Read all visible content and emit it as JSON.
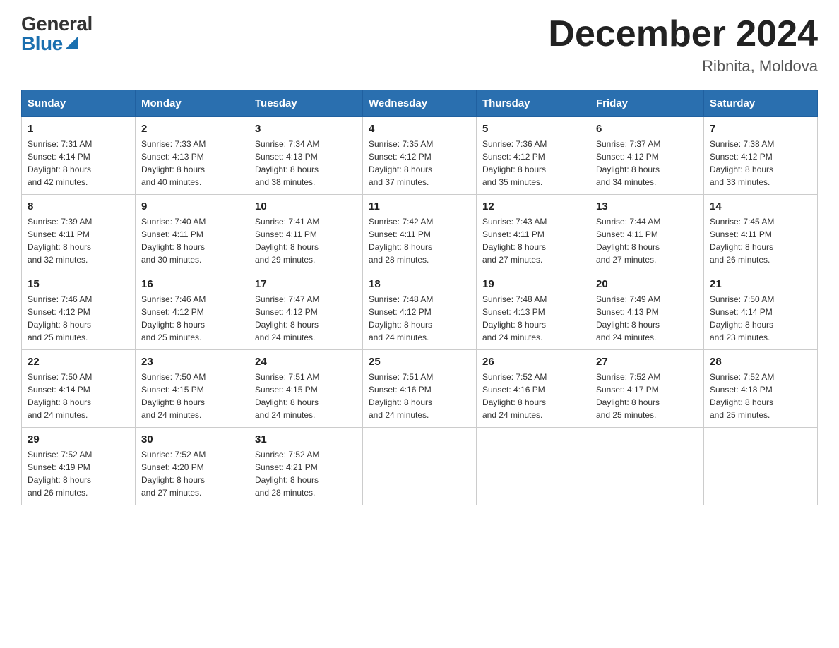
{
  "logo": {
    "general": "General",
    "blue": "Blue"
  },
  "header": {
    "title": "December 2024",
    "subtitle": "Ribnita, Moldova"
  },
  "days_of_week": [
    "Sunday",
    "Monday",
    "Tuesday",
    "Wednesday",
    "Thursday",
    "Friday",
    "Saturday"
  ],
  "weeks": [
    [
      {
        "day": "1",
        "sunrise": "7:31 AM",
        "sunset": "4:14 PM",
        "daylight": "8 hours and 42 minutes."
      },
      {
        "day": "2",
        "sunrise": "7:33 AM",
        "sunset": "4:13 PM",
        "daylight": "8 hours and 40 minutes."
      },
      {
        "day": "3",
        "sunrise": "7:34 AM",
        "sunset": "4:13 PM",
        "daylight": "8 hours and 38 minutes."
      },
      {
        "day": "4",
        "sunrise": "7:35 AM",
        "sunset": "4:12 PM",
        "daylight": "8 hours and 37 minutes."
      },
      {
        "day": "5",
        "sunrise": "7:36 AM",
        "sunset": "4:12 PM",
        "daylight": "8 hours and 35 minutes."
      },
      {
        "day": "6",
        "sunrise": "7:37 AM",
        "sunset": "4:12 PM",
        "daylight": "8 hours and 34 minutes."
      },
      {
        "day": "7",
        "sunrise": "7:38 AM",
        "sunset": "4:12 PM",
        "daylight": "8 hours and 33 minutes."
      }
    ],
    [
      {
        "day": "8",
        "sunrise": "7:39 AM",
        "sunset": "4:11 PM",
        "daylight": "8 hours and 32 minutes."
      },
      {
        "day": "9",
        "sunrise": "7:40 AM",
        "sunset": "4:11 PM",
        "daylight": "8 hours and 30 minutes."
      },
      {
        "day": "10",
        "sunrise": "7:41 AM",
        "sunset": "4:11 PM",
        "daylight": "8 hours and 29 minutes."
      },
      {
        "day": "11",
        "sunrise": "7:42 AM",
        "sunset": "4:11 PM",
        "daylight": "8 hours and 28 minutes."
      },
      {
        "day": "12",
        "sunrise": "7:43 AM",
        "sunset": "4:11 PM",
        "daylight": "8 hours and 27 minutes."
      },
      {
        "day": "13",
        "sunrise": "7:44 AM",
        "sunset": "4:11 PM",
        "daylight": "8 hours and 27 minutes."
      },
      {
        "day": "14",
        "sunrise": "7:45 AM",
        "sunset": "4:11 PM",
        "daylight": "8 hours and 26 minutes."
      }
    ],
    [
      {
        "day": "15",
        "sunrise": "7:46 AM",
        "sunset": "4:12 PM",
        "daylight": "8 hours and 25 minutes."
      },
      {
        "day": "16",
        "sunrise": "7:46 AM",
        "sunset": "4:12 PM",
        "daylight": "8 hours and 25 minutes."
      },
      {
        "day": "17",
        "sunrise": "7:47 AM",
        "sunset": "4:12 PM",
        "daylight": "8 hours and 24 minutes."
      },
      {
        "day": "18",
        "sunrise": "7:48 AM",
        "sunset": "4:12 PM",
        "daylight": "8 hours and 24 minutes."
      },
      {
        "day": "19",
        "sunrise": "7:48 AM",
        "sunset": "4:13 PM",
        "daylight": "8 hours and 24 minutes."
      },
      {
        "day": "20",
        "sunrise": "7:49 AM",
        "sunset": "4:13 PM",
        "daylight": "8 hours and 24 minutes."
      },
      {
        "day": "21",
        "sunrise": "7:50 AM",
        "sunset": "4:14 PM",
        "daylight": "8 hours and 23 minutes."
      }
    ],
    [
      {
        "day": "22",
        "sunrise": "7:50 AM",
        "sunset": "4:14 PM",
        "daylight": "8 hours and 24 minutes."
      },
      {
        "day": "23",
        "sunrise": "7:50 AM",
        "sunset": "4:15 PM",
        "daylight": "8 hours and 24 minutes."
      },
      {
        "day": "24",
        "sunrise": "7:51 AM",
        "sunset": "4:15 PM",
        "daylight": "8 hours and 24 minutes."
      },
      {
        "day": "25",
        "sunrise": "7:51 AM",
        "sunset": "4:16 PM",
        "daylight": "8 hours and 24 minutes."
      },
      {
        "day": "26",
        "sunrise": "7:52 AM",
        "sunset": "4:16 PM",
        "daylight": "8 hours and 24 minutes."
      },
      {
        "day": "27",
        "sunrise": "7:52 AM",
        "sunset": "4:17 PM",
        "daylight": "8 hours and 25 minutes."
      },
      {
        "day": "28",
        "sunrise": "7:52 AM",
        "sunset": "4:18 PM",
        "daylight": "8 hours and 25 minutes."
      }
    ],
    [
      {
        "day": "29",
        "sunrise": "7:52 AM",
        "sunset": "4:19 PM",
        "daylight": "8 hours and 26 minutes."
      },
      {
        "day": "30",
        "sunrise": "7:52 AM",
        "sunset": "4:20 PM",
        "daylight": "8 hours and 27 minutes."
      },
      {
        "day": "31",
        "sunrise": "7:52 AM",
        "sunset": "4:21 PM",
        "daylight": "8 hours and 28 minutes."
      },
      null,
      null,
      null,
      null
    ]
  ],
  "labels": {
    "sunrise": "Sunrise:",
    "sunset": "Sunset:",
    "daylight": "Daylight:"
  }
}
